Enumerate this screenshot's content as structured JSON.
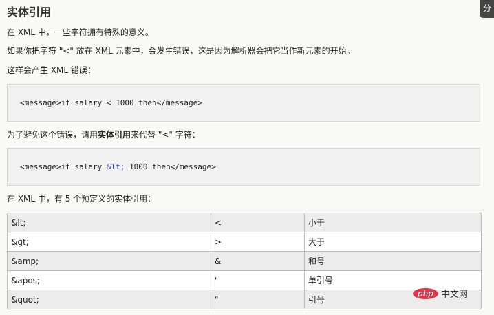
{
  "title": "实体引用",
  "p1": "在 XML 中，一些字符拥有特殊的意义。",
  "p2": "如果你把字符 \"<\" 放在 XML 元素中，会发生错误，这是因为解析器会把它当作新元素的开始。",
  "p3": "这样会产生 XML 错误：",
  "code1": "<message>if salary < 1000 then</message>",
  "p4_pre": "为了避免这个错误，请用",
  "p4_bold": "实体引用",
  "p4_post": "来代替 \"<\" 字符：",
  "code2_pre": "<message>if salary ",
  "code2_ent": "&lt;",
  "code2_post": " 1000 then</message>",
  "p5": "在 XML 中，有 5 个预定义的实体引用：",
  "table": [
    [
      "&lt;",
      "<",
      "小于"
    ],
    [
      "&gt;",
      ">",
      "大于"
    ],
    [
      "&amp;",
      "&",
      "和号"
    ],
    [
      "&apos;",
      "'",
      "单引号"
    ],
    [
      "&quot;",
      "\"",
      "引号"
    ]
  ],
  "share_label": "分",
  "watermark": {
    "logo": "php",
    "text": "中文网"
  }
}
